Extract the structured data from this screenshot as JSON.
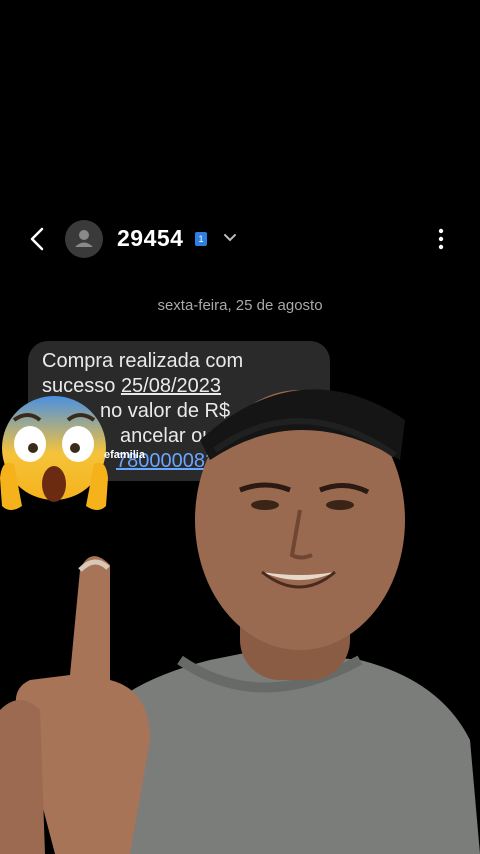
{
  "header": {
    "contact_name": "29454",
    "sim_badge": "1",
    "icons": [
      "back-arrow-icon",
      "avatar-icon",
      "chevron-down-icon",
      "more-vert-icon"
    ]
  },
  "conversation": {
    "date_label": "sexta-feira, 25 de agosto",
    "message": {
      "line1": "Compra realizada com",
      "line2_prefix": "sucesso ",
      "line2_date": "25/08/2023",
      "line3": "no valor de R$",
      "line4": "ancelar ou",
      "line5_link": "780000082"
    }
  },
  "overlay": {
    "watermark": "efamilia",
    "emoji": "fearful-face-emoji"
  },
  "colors": {
    "background": "#000000",
    "bubble": "#2a2a2a",
    "link": "#6aa5ff",
    "sim_badge": "#2f7fe0",
    "date_text": "#a9a9a9"
  }
}
